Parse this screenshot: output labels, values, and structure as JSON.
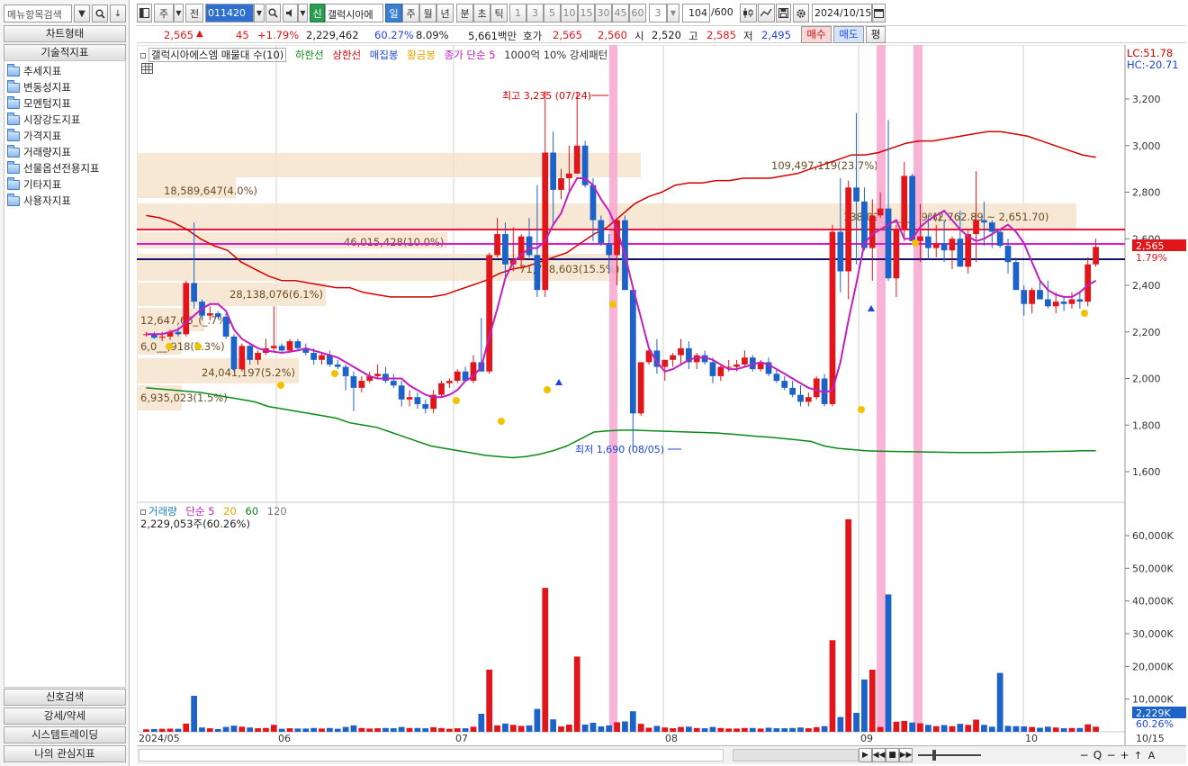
{
  "left_panel": {
    "search_placeholder": "메뉴항목검색",
    "chart_type_label": "차트형태",
    "tech_indicator_label": "기술적지표",
    "tree": [
      "추세지표",
      "변동성지표",
      "모멘텀지표",
      "시장강도지표",
      "가격지표",
      "거래량지표",
      "선물옵션전용지표",
      "기타지표",
      "사용자지표"
    ],
    "bottom_buttons": [
      "신호검색",
      "강세/약세",
      "시스템트레이딩",
      "나의 관심지표"
    ]
  },
  "toolbar": {
    "period_label": "주",
    "prev_label": "전",
    "code": "011420",
    "shin": "신",
    "stock_name": "갤럭시아에",
    "period_tabs": [
      "일",
      "주",
      "월",
      "년",
      "분",
      "초",
      "틱"
    ],
    "active_tab": "일",
    "minute_values": [
      "1",
      "3",
      "5",
      "10",
      "15",
      "30",
      "45",
      "60"
    ],
    "count_select": "3",
    "bar_count": "104",
    "bar_total": "/600",
    "date": "2024/10/15"
  },
  "quote": {
    "price": "2,565",
    "change": "45",
    "change_pct": "+1.79%",
    "volume": "2,229,462",
    "vol_ratio": "60.27%",
    "turnover": "8.09%",
    "amount": "5,661백만",
    "bid_label": "호가",
    "ask": "2,565",
    "bid": "2,560",
    "open_label": "시",
    "open": "2,520",
    "high_label": "고",
    "high": "2,585",
    "low_label": "저",
    "low": "2,495",
    "buy_label": "매수",
    "sell_label": "매도",
    "eval_label": "평"
  },
  "chart": {
    "legend_price": {
      "name": "갤럭시아에스엠 매물대 수(10)",
      "items": [
        {
          "label": "하한선",
          "color": "#0a8a18"
        },
        {
          "label": "상한선",
          "color": "#d40000"
        },
        {
          "label": "매집봉",
          "color": "#1c46d8"
        },
        {
          "label": "황금봉",
          "color": "#e0a800"
        },
        {
          "label": "종가 단순 5",
          "color": "#c020c0"
        },
        {
          "label": "1000억 10% 강세패턴",
          "color": "#333333"
        }
      ]
    },
    "lc": "LC:51.78",
    "hc": "HC:-20.71",
    "price_tag": "2,565",
    "pct_tag": "1.79%",
    "high_annot": "최고 3,235 (07/24)",
    "low_annot": "최저 1,690 (08/05)",
    "volume_profile": [
      {
        "label": "109,497,119(23.7%)"
      },
      {
        "label": "138,02_,___(__.9%)"
      },
      {
        "label": "46,015,428(10.0%)"
      },
      {
        "label": "71,718,603(15.5%)"
      },
      {
        "label": "18,589,647(4.0%)"
      },
      {
        "label": "28,138,076(6.1%)"
      },
      {
        "label": "12,647,66_(_.7%)"
      },
      {
        "label": "6,0__,918(1.3%)"
      },
      {
        "label": "24,041,197(5.2%)"
      },
      {
        "label": "6,935,023(1.5%)"
      }
    ],
    "range_annot": "(2,762.89 ~ 2,651.70)",
    "price_axis": [
      "3,200",
      "3,000",
      "2,800",
      "2,600",
      "2,400",
      "2,200",
      "2,000",
      "1,800",
      "1,600"
    ],
    "volume_axis": [
      "60,000K",
      "50,000K",
      "40,000K",
      "30,000K",
      "20,000K",
      "10,000K"
    ],
    "legend_volume": {
      "items": [
        {
          "label": "거래량",
          "color": "#1c7fbf"
        },
        {
          "label": "단순 5",
          "color": "#c020c0"
        },
        {
          "label": "20",
          "color": "#e0a800"
        },
        {
          "label": "60",
          "color": "#0a8a18"
        },
        {
          "label": "120",
          "color": "#777777"
        }
      ],
      "value": "2,229,053주(60.26%)"
    },
    "vol_tag": "2,229K",
    "vol_pct_tag": "60.26%",
    "x_labels": [
      "2024/05",
      "06",
      "07",
      "08",
      "09",
      "10",
      "10/15"
    ]
  },
  "chart_data": {
    "type": "candlestick",
    "title": "갤럭시아에스엠 매물대 수(10)",
    "ylim": [
      1600,
      3300
    ],
    "x_start": "2024/05",
    "x_end": "2024/10/15",
    "candles": [
      [
        2190,
        2200,
        2180,
        2190
      ],
      [
        2190,
        2200,
        2170,
        2175
      ],
      [
        2175,
        2200,
        2160,
        2180
      ],
      [
        2180,
        2210,
        2165,
        2200
      ],
      [
        2200,
        2220,
        2180,
        2190
      ],
      [
        2190,
        2420,
        2180,
        2410
      ],
      [
        2410,
        2670,
        2300,
        2330
      ],
      [
        2330,
        2340,
        2250,
        2270
      ],
      [
        2270,
        2310,
        2250,
        2280
      ],
      [
        2280,
        2290,
        2260,
        2265
      ],
      [
        2265,
        2280,
        2170,
        2180
      ],
      [
        2180,
        2190,
        2030,
        2040
      ],
      [
        2040,
        2150,
        2030,
        2140
      ],
      [
        2140,
        2150,
        2060,
        2080
      ],
      [
        2080,
        2120,
        2060,
        2110
      ],
      [
        2110,
        2170,
        2100,
        2130
      ],
      [
        2130,
        2310,
        2120,
        2140
      ],
      [
        2140,
        2150,
        2110,
        2120
      ],
      [
        2120,
        2170,
        2110,
        2160
      ],
      [
        2160,
        2170,
        2120,
        2130
      ],
      [
        2130,
        2150,
        2100,
        2110
      ],
      [
        2110,
        2130,
        2060,
        2080
      ],
      [
        2080,
        2110,
        2060,
        2100
      ],
      [
        2100,
        2120,
        2050,
        2060
      ],
      [
        2060,
        2080,
        2040,
        2050
      ],
      [
        2050,
        2060,
        1950,
        2010
      ],
      [
        2010,
        2030,
        1860,
        1960
      ],
      [
        1960,
        2010,
        1940,
        1990
      ],
      [
        1990,
        2030,
        1980,
        2010
      ],
      [
        2010,
        2060,
        2000,
        2020
      ],
      [
        2020,
        2050,
        1980,
        1990
      ],
      [
        1990,
        2020,
        1960,
        1970
      ],
      [
        1970,
        1990,
        1880,
        1910
      ],
      [
        1910,
        1950,
        1880,
        1920
      ],
      [
        1920,
        1940,
        1870,
        1890
      ],
      [
        1890,
        1910,
        1850,
        1870
      ],
      [
        1870,
        1950,
        1850,
        1930
      ],
      [
        1930,
        1990,
        1920,
        1980
      ],
      [
        1980,
        2000,
        1960,
        1990
      ],
      [
        1990,
        2040,
        1980,
        2030
      ],
      [
        2030,
        2050,
        1990,
        1990
      ],
      [
        1990,
        2100,
        1980,
        2070
      ],
      [
        2070,
        2260,
        2030,
        2030
      ],
      [
        2030,
        2540,
        2020,
        2530
      ],
      [
        2530,
        2690,
        2520,
        2620
      ],
      [
        2620,
        2670,
        2430,
        2490
      ],
      [
        2490,
        2650,
        2460,
        2510
      ],
      [
        2510,
        2620,
        2470,
        2610
      ],
      [
        2610,
        2690,
        2520,
        2530
      ],
      [
        2530,
        2830,
        2350,
        2380
      ],
      [
        2380,
        3235,
        2350,
        2970
      ],
      [
        2970,
        3060,
        2660,
        2810
      ],
      [
        2810,
        2900,
        2770,
        2860
      ],
      [
        2860,
        3000,
        2800,
        2880
      ],
      [
        2880,
        3230,
        2880,
        3000
      ],
      [
        3000,
        3020,
        2820,
        2830
      ],
      [
        2830,
        2860,
        2590,
        2680
      ],
      [
        2680,
        2700,
        2570,
        2580
      ],
      [
        2580,
        2620,
        2450,
        2530
      ],
      [
        2530,
        2690,
        2400,
        2680
      ],
      [
        2680,
        2700,
        2380,
        2380
      ],
      [
        2380,
        2400,
        1690,
        1850
      ],
      [
        1850,
        2070,
        1840,
        2070
      ],
      [
        2070,
        2140,
        2060,
        2120
      ],
      [
        2120,
        2170,
        2020,
        2050
      ],
      [
        2050,
        2080,
        1990,
        2080
      ],
      [
        2080,
        2110,
        2050,
        2100
      ],
      [
        2100,
        2170,
        2060,
        2130
      ],
      [
        2130,
        2160,
        2040,
        2070
      ],
      [
        2070,
        2110,
        2040,
        2100
      ],
      [
        2100,
        2120,
        2060,
        2070
      ],
      [
        2070,
        2090,
        1980,
        2010
      ],
      [
        2010,
        2060,
        1990,
        2050
      ],
      [
        2050,
        2080,
        2030,
        2050
      ],
      [
        2050,
        2080,
        2030,
        2060
      ],
      [
        2060,
        2120,
        2050,
        2090
      ],
      [
        2090,
        2100,
        2030,
        2040
      ],
      [
        2040,
        2080,
        2030,
        2070
      ],
      [
        2070,
        2090,
        2010,
        2020
      ],
      [
        2020,
        2040,
        1980,
        1990
      ],
      [
        1990,
        2010,
        1950,
        1960
      ],
      [
        1960,
        1990,
        1920,
        1930
      ],
      [
        1930,
        1970,
        1880,
        1900
      ],
      [
        1900,
        1940,
        1880,
        1920
      ],
      [
        1920,
        2010,
        1910,
        2000
      ],
      [
        2000,
        2020,
        1880,
        1890
      ],
      [
        1890,
        2660,
        1880,
        2630
      ],
      [
        2630,
        2860,
        2370,
        2460
      ],
      [
        2460,
        2850,
        2340,
        2820
      ],
      [
        2820,
        3140,
        2490,
        2760
      ],
      [
        2760,
        2820,
        2550,
        2560
      ],
      [
        2560,
        2770,
        2420,
        2700
      ],
      [
        2700,
        2800,
        2690,
        2730
      ],
      [
        2730,
        3110,
        2420,
        2430
      ],
      [
        2430,
        2660,
        2350,
        2640
      ],
      [
        2640,
        2930,
        2590,
        2870
      ],
      [
        2870,
        2880,
        2600,
        2590
      ],
      [
        2590,
        2750,
        2500,
        2610
      ],
      [
        2610,
        2700,
        2510,
        2560
      ],
      [
        2560,
        2660,
        2520,
        2580
      ],
      [
        2580,
        2680,
        2500,
        2550
      ],
      [
        2550,
        2610,
        2470,
        2600
      ],
      [
        2600,
        2720,
        2490,
        2480
      ],
      [
        2480,
        2640,
        2450,
        2620
      ],
      [
        2620,
        2890,
        2500,
        2680
      ],
      [
        2680,
        2760,
        2570,
        2670
      ],
      [
        2670,
        2680,
        2560,
        2630
      ],
      [
        2630,
        2640,
        2560,
        2570
      ],
      [
        2570,
        2600,
        2450,
        2500
      ],
      [
        2500,
        2520,
        2380,
        2380
      ],
      [
        2380,
        2400,
        2270,
        2320
      ],
      [
        2320,
        2390,
        2280,
        2380
      ],
      [
        2380,
        2420,
        2340,
        2340
      ],
      [
        2340,
        2420,
        2300,
        2310
      ],
      [
        2310,
        2370,
        2280,
        2330
      ],
      [
        2330,
        2350,
        2290,
        2320
      ],
      [
        2320,
        2370,
        2300,
        2340
      ],
      [
        2340,
        2370,
        2300,
        2330
      ],
      [
        2330,
        2520,
        2310,
        2490
      ],
      [
        2490,
        2600,
        2480,
        2565
      ]
    ],
    "upper_band": [
      2700,
      2690,
      2670,
      2640,
      2600,
      2570,
      2550,
      2500,
      2470,
      2440,
      2420,
      2420,
      2410,
      2400,
      2390,
      2390,
      2370,
      2360,
      2350,
      2350,
      2350,
      2350,
      2360,
      2380,
      2400,
      2420,
      2450,
      2470,
      2480,
      2500,
      2520,
      2540,
      2580,
      2620,
      2650,
      2700,
      2750,
      2780,
      2800,
      2830,
      2840,
      2840,
      2850,
      2850,
      2860,
      2860,
      2860,
      2870,
      2880,
      2900,
      2920,
      2940,
      2960,
      2960,
      2970,
      2990,
      3010,
      3020,
      3020,
      3030,
      3040,
      3050,
      3060,
      3060,
      3050,
      3040,
      3020,
      3000,
      2980,
      2960,
      2950
    ],
    "lower_band": [
      1960,
      1955,
      1950,
      1945,
      1940,
      1930,
      1920,
      1910,
      1900,
      1880,
      1870,
      1860,
      1850,
      1840,
      1830,
      1810,
      1800,
      1790,
      1770,
      1750,
      1730,
      1710,
      1700,
      1690,
      1680,
      1670,
      1665,
      1660,
      1665,
      1675,
      1690,
      1710,
      1740,
      1770,
      1775,
      1778,
      1778,
      1776,
      1774,
      1772,
      1770,
      1768,
      1766,
      1762,
      1757,
      1752,
      1748,
      1742,
      1736,
      1730,
      1710,
      1700,
      1695,
      1690,
      1688,
      1687,
      1686,
      1685,
      1684,
      1683,
      1682,
      1682,
      1682,
      1683,
      1684,
      1685,
      1686,
      1687,
      1688,
      1690,
      1690
    ],
    "ma5": [
      2190,
      2190,
      2190,
      2200,
      2210,
      2240,
      2270,
      2300,
      2320,
      2320,
      2290,
      2210,
      2170,
      2150,
      2130,
      2120,
      2115,
      2110,
      2115,
      2120,
      2130,
      2120,
      2110,
      2100,
      2090,
      2070,
      2050,
      2030,
      2010,
      2000,
      2000,
      2000,
      2000,
      1970,
      1950,
      1930,
      1920,
      1920,
      1930,
      1950,
      1990,
      2010,
      2050,
      2180,
      2300,
      2430,
      2500,
      2530,
      2560,
      2560,
      2590,
      2660,
      2710,
      2800,
      2860,
      2860,
      2830,
      2770,
      2720,
      2640,
      2530,
      2390,
      2260,
      2130,
      2070,
      2030,
      2040,
      2060,
      2080,
      2090,
      2090,
      2080,
      2060,
      2040,
      2040,
      2050,
      2060,
      2070,
      2060,
      2040,
      2020,
      2000,
      1980,
      1960,
      1950,
      1940,
      1950,
      2070,
      2250,
      2410,
      2580,
      2620,
      2640,
      2660,
      2680,
      2600,
      2600,
      2650,
      2680,
      2700,
      2720,
      2680,
      2640,
      2610,
      2590,
      2600,
      2620,
      2640,
      2660,
      2630,
      2580,
      2500,
      2420,
      2380,
      2360,
      2350,
      2350,
      2370,
      2400,
      2420
    ]
  }
}
